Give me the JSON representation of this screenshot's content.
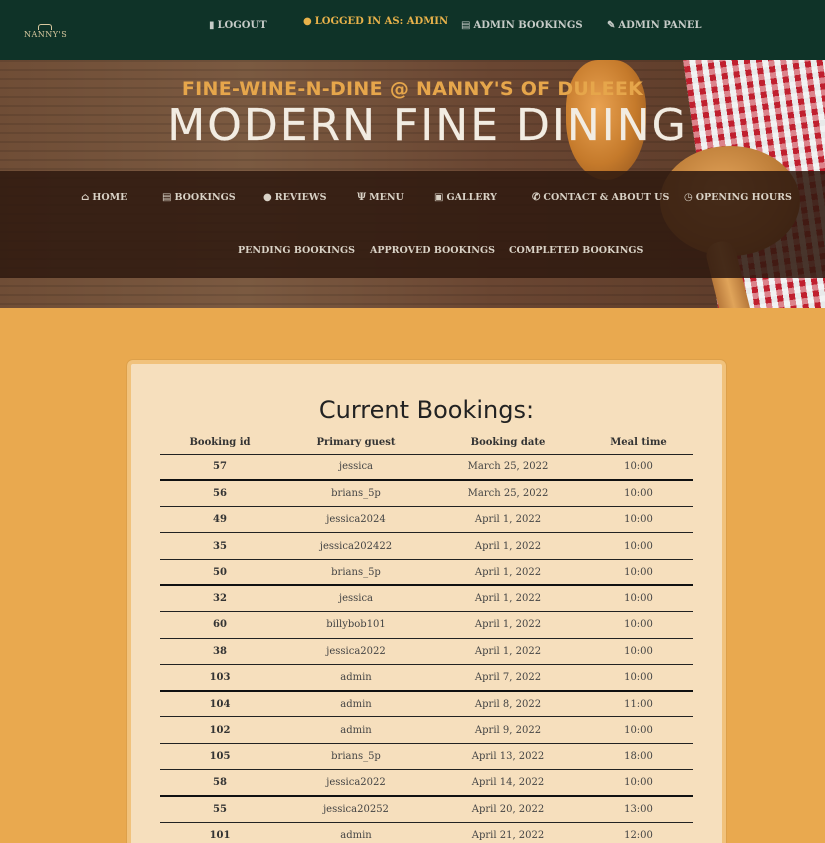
{
  "brand": {
    "logo_text": "NANNY'S"
  },
  "topnav": {
    "logout": "LOGOUT",
    "logged_in": "LOGGED IN AS: ADMIN",
    "admin_bookings": "ADMIN BOOKINGS",
    "admin_panel": "ADMIN PANEL"
  },
  "hero": {
    "title": "FINE-WINE-N-DINE @ NANNY'S OF DULEEK",
    "subtitle": "MODERN FINE DINING"
  },
  "menu": {
    "home": "HOME",
    "bookings": "BOOKINGS",
    "reviews": "REVIEWS",
    "menu": "MENU",
    "gallery": "GALLERY",
    "contact": "CONTACT & ABOUT US",
    "opening_hours": "OPENING HOURS",
    "pending": "PENDING BOOKINGS",
    "approved": "APPROVED BOOKINGS",
    "completed": "COMPLETED BOOKINGS"
  },
  "bookings": {
    "title": "Current Bookings:",
    "columns": [
      "Booking id",
      "Primary guest",
      "Booking date",
      "Meal time"
    ],
    "rows": [
      [
        "57",
        "jessica",
        "March 25, 2022",
        "10:00"
      ],
      [
        "56",
        "brians_5p",
        "March 25, 2022",
        "10:00"
      ],
      [
        "49",
        "jessica2024",
        "April 1, 2022",
        "10:00"
      ],
      [
        "35",
        "jessica202422",
        "April 1, 2022",
        "10:00"
      ],
      [
        "50",
        "brians_5p",
        "April 1, 2022",
        "10:00"
      ],
      [
        "32",
        "jessica",
        "April 1, 2022",
        "10:00"
      ],
      [
        "60",
        "billybob101",
        "April 1, 2022",
        "10:00"
      ],
      [
        "38",
        "jessica2022",
        "April 1, 2022",
        "10:00"
      ],
      [
        "103",
        "admin",
        "April 7, 2022",
        "10:00"
      ],
      [
        "104",
        "admin",
        "April 8, 2022",
        "11:00"
      ],
      [
        "102",
        "admin",
        "April 9, 2022",
        "10:00"
      ],
      [
        "105",
        "brians_5p",
        "April 13, 2022",
        "18:00"
      ],
      [
        "58",
        "jessica2022",
        "April 14, 2022",
        "10:00"
      ],
      [
        "55",
        "jessica20252",
        "April 20, 2022",
        "13:00"
      ],
      [
        "101",
        "admin",
        "April 21, 2022",
        "12:00"
      ]
    ]
  },
  "colors": {
    "topnav_bg": "#0f3328",
    "accent": "#e8b24a",
    "page_bg": "#e9a94f",
    "card_bg": "#f6dfbd"
  },
  "icons": [
    "logout-icon",
    "user-icon",
    "book-icon",
    "pencil-icon",
    "home-icon",
    "comment-icon",
    "cutlery-icon",
    "gallery-icon",
    "phone-icon",
    "clock-icon"
  ]
}
